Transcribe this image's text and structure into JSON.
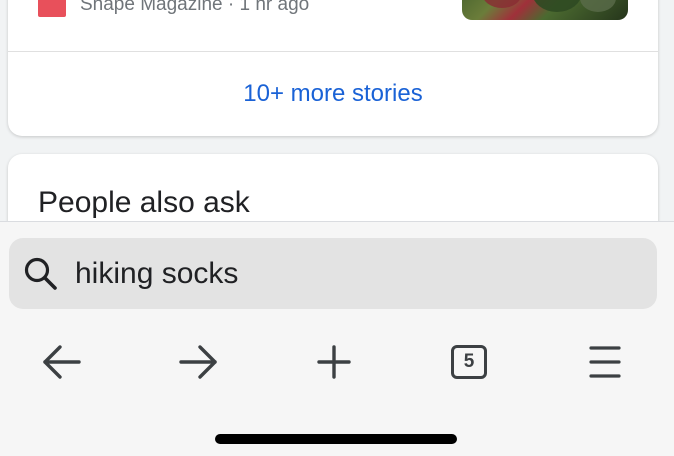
{
  "results": {
    "top_story": {
      "source_meta": "Shape Magazine · 1 hr ago",
      "more_stories_link": "10+ more stories"
    },
    "people_also_ask": {
      "title": "People also ask"
    }
  },
  "search_bar": {
    "query": "hiking socks",
    "icon": "search-icon"
  },
  "bottom_toolbar": {
    "back_icon": "arrow-left-icon",
    "forward_icon": "arrow-right-icon",
    "new_tab_icon": "plus-icon",
    "tab_count": "5",
    "menu_icon": "hamburger-menu-icon"
  },
  "colors": {
    "link": "#1a62d6",
    "source_logo": "#e8505b",
    "toolbar_bg": "#f6f6f6",
    "search_pill_bg": "#e3e3e3"
  }
}
